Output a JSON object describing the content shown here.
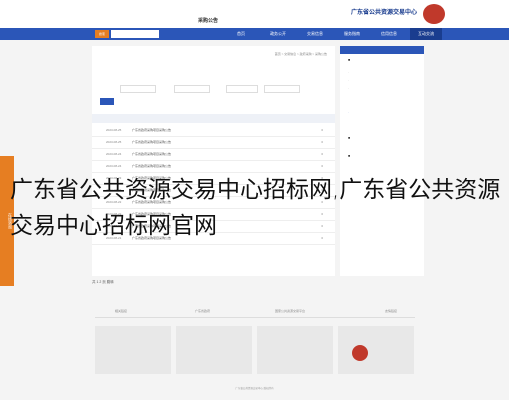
{
  "header": {
    "title": "广东省公共资源交易中心"
  },
  "nav": {
    "tabs": [
      "首页",
      "政务公开",
      "交易信息",
      "服务指南",
      "信用信息",
      "互动交流"
    ],
    "active_index": 5
  },
  "search": {
    "tag": "搜索"
  },
  "breadcrumb": "首页 > 交易信息 > 政府采购 > 采购公告",
  "page_title": "采购公告",
  "rows": [
    {
      "date": "2023-08-25",
      "title": "广东省政府采购项目采购公告",
      "num": "0"
    },
    {
      "date": "2023-08-25",
      "title": "广东省政府采购项目采购公告",
      "num": "0"
    },
    {
      "date": "2023-08-24",
      "title": "广东省政府采购项目采购公告",
      "num": "0"
    },
    {
      "date": "2023-08-24",
      "title": "广东省政府采购项目采购公告",
      "num": "0"
    },
    {
      "date": "2023-08-23",
      "title": "广东省政府采购项目采购公告",
      "num": "0"
    },
    {
      "date": "2023-08-23",
      "title": "广东省政府采购项目采购公告",
      "num": "0"
    },
    {
      "date": "2023-08-22",
      "title": "广东省政府采购项目采购公告",
      "num": "0"
    },
    {
      "date": "2023-08-22",
      "title": "广东省政府采购项目采购公告",
      "num": "0"
    },
    {
      "date": "2023-08-21",
      "title": "广东省政府采购项目采购公告",
      "num": "0"
    },
    {
      "date": "2023-08-21",
      "title": "广东省政府采购项目采购公告",
      "num": "0"
    }
  ],
  "pager": "共 1 2 页 跳转",
  "overlay_text": "广东省公共资源交易中心招标网,广东省公共资源交易中心招标网官网",
  "float_btn": "在线咨询",
  "footer": {
    "links": [
      "相关链接",
      "广东省政府",
      "国家公共资源交易平台",
      "友情链接"
    ]
  },
  "copyright": "广东省公共资源交易中心 版权所有"
}
